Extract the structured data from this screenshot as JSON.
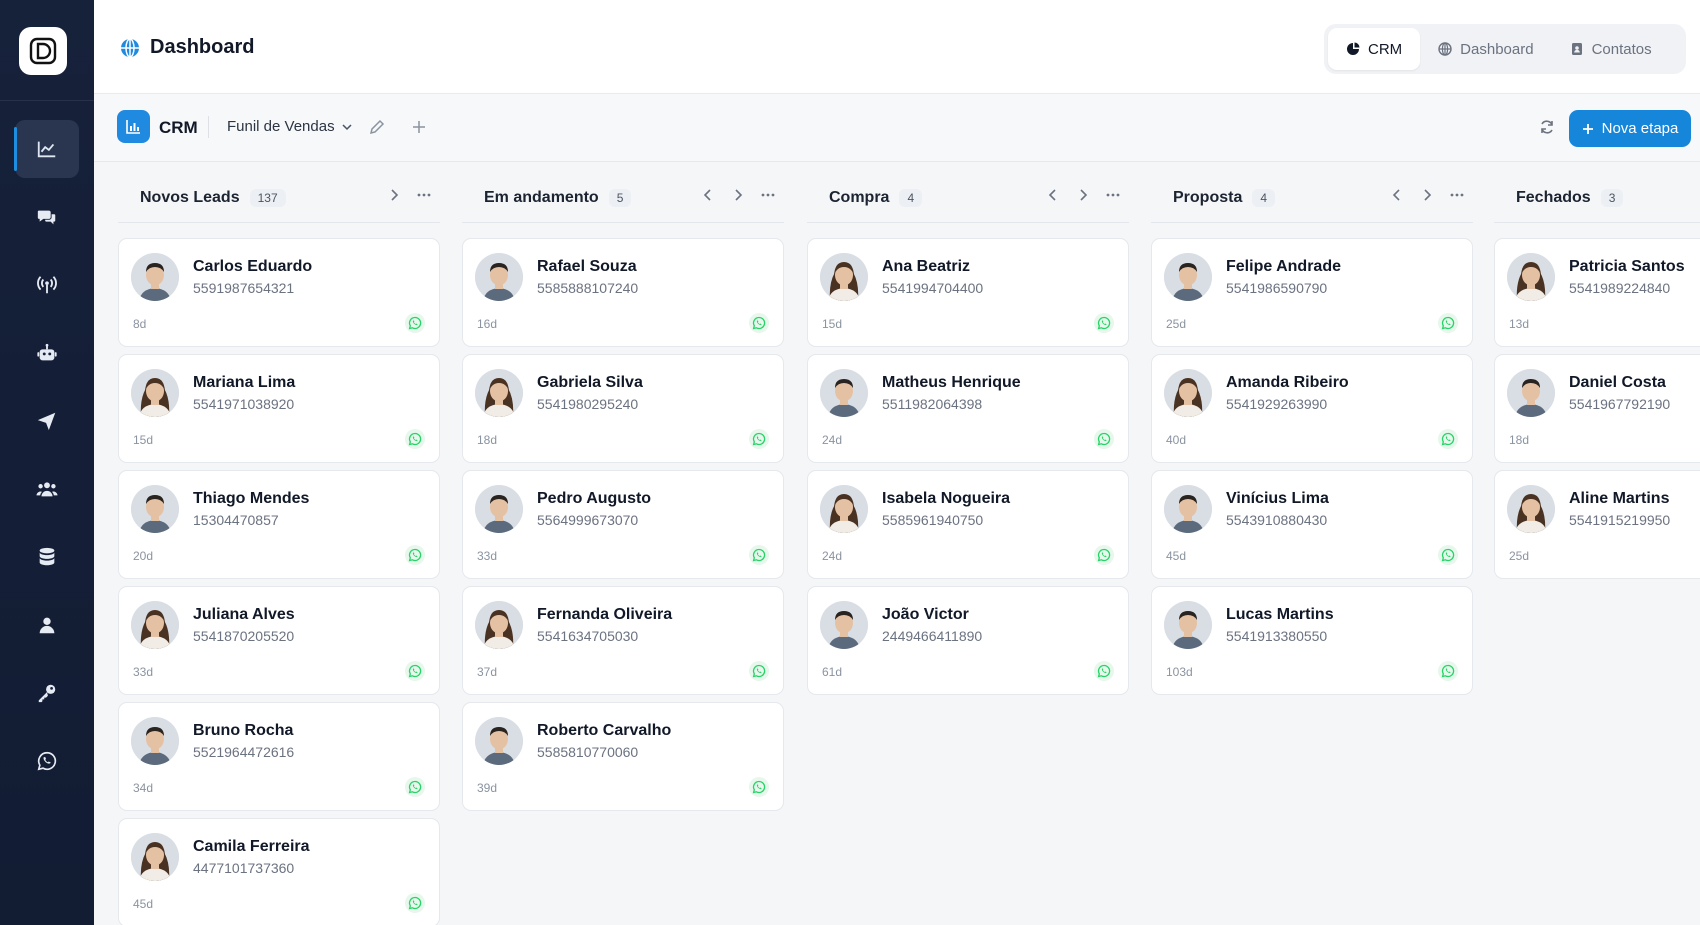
{
  "page": {
    "title": "Dashboard"
  },
  "top_nav": [
    {
      "label": "CRM",
      "icon": "pie-chart-icon",
      "active": true
    },
    {
      "label": "Dashboard",
      "icon": "globe-icon",
      "active": false
    },
    {
      "label": "Contatos",
      "icon": "contacts-book-icon",
      "active": false
    }
  ],
  "sidebar": {
    "items": [
      {
        "icon": "chart-line-icon",
        "active": true
      },
      {
        "icon": "chat-bubbles-icon",
        "active": false
      },
      {
        "icon": "broadcast-antenna-icon",
        "active": false
      },
      {
        "icon": "robot-icon",
        "active": false
      },
      {
        "icon": "paper-plane-icon",
        "active": false
      },
      {
        "icon": "users-icon",
        "active": false
      },
      {
        "icon": "database-icon",
        "active": false
      },
      {
        "icon": "user-icon",
        "active": false
      },
      {
        "icon": "key-icon",
        "active": false
      },
      {
        "icon": "whatsapp-icon",
        "active": false
      }
    ]
  },
  "toolbar": {
    "crm_label": "CRM",
    "funnel_label": "Funil de Vendas",
    "new_stage_label": "Nova etapa"
  },
  "columns": [
    {
      "title": "Novos Leads",
      "count": "137",
      "has_prev": false,
      "cards": [
        {
          "name": "Carlos Eduardo",
          "phone": "5591987654321",
          "age": "8d",
          "avatar": "man"
        },
        {
          "name": "Mariana Lima",
          "phone": "5541971038920",
          "age": "15d",
          "avatar": "woman"
        },
        {
          "name": "Thiago Mendes",
          "phone": "15304470857",
          "age": "20d",
          "avatar": "man"
        },
        {
          "name": "Juliana Alves",
          "phone": "5541870205520",
          "age": "33d",
          "avatar": "woman"
        },
        {
          "name": "Bruno Rocha",
          "phone": "5521964472616",
          "age": "34d",
          "avatar": "man"
        },
        {
          "name": "Camila Ferreira",
          "phone": "4477101737360",
          "age": "45d",
          "avatar": "woman"
        }
      ]
    },
    {
      "title": "Em andamento",
      "count": "5",
      "has_prev": true,
      "cards": [
        {
          "name": "Rafael Souza",
          "phone": "5585888107240",
          "age": "16d",
          "avatar": "man"
        },
        {
          "name": "Gabriela Silva",
          "phone": "5541980295240",
          "age": "18d",
          "avatar": "woman"
        },
        {
          "name": "Pedro Augusto",
          "phone": "5564999673070",
          "age": "33d",
          "avatar": "man"
        },
        {
          "name": "Fernanda Oliveira",
          "phone": "5541634705030",
          "age": "37d",
          "avatar": "woman"
        },
        {
          "name": "Roberto Carvalho",
          "phone": "5585810770060",
          "age": "39d",
          "avatar": "man"
        }
      ]
    },
    {
      "title": "Compra",
      "count": "4",
      "has_prev": true,
      "cards": [
        {
          "name": "Ana Beatriz",
          "phone": "5541994704400",
          "age": "15d",
          "avatar": "woman"
        },
        {
          "name": "Matheus Henrique",
          "phone": "5511982064398",
          "age": "24d",
          "avatar": "man"
        },
        {
          "name": "Isabela Nogueira",
          "phone": "5585961940750",
          "age": "24d",
          "avatar": "woman"
        },
        {
          "name": "João Victor",
          "phone": "2449466411890",
          "age": "61d",
          "avatar": "man"
        }
      ]
    },
    {
      "title": "Proposta",
      "count": "4",
      "has_prev": true,
      "cards": [
        {
          "name": "Felipe Andrade",
          "phone": "5541986590790",
          "age": "25d",
          "avatar": "man"
        },
        {
          "name": "Amanda Ribeiro",
          "phone": "5541929263990",
          "age": "40d",
          "avatar": "woman"
        },
        {
          "name": "Vinícius Lima",
          "phone": "5543910880430",
          "age": "45d",
          "avatar": "man"
        },
        {
          "name": "Lucas Martins",
          "phone": "5541913380550",
          "age": "103d",
          "avatar": "man"
        }
      ]
    },
    {
      "title": "Fechados",
      "count": "3",
      "has_prev": true,
      "cards": [
        {
          "name": "Patricia Santos",
          "phone": "5541989224840",
          "age": "13d",
          "avatar": "woman"
        },
        {
          "name": "Daniel Costa",
          "phone": "5541967792190",
          "age": "18d",
          "avatar": "man"
        },
        {
          "name": "Aline Martins",
          "phone": "5541915219950",
          "age": "25d",
          "avatar": "woman"
        }
      ]
    }
  ],
  "colors": {
    "sidebar_bg": "#16213a",
    "accent": "#1586da",
    "whatsapp": "#25d366"
  }
}
